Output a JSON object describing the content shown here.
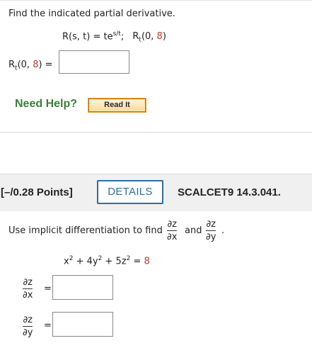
{
  "problem1": {
    "prompt": "Find the indicated partial derivative.",
    "func_lhs": "R(s, t) = te",
    "func_exp": "s/t",
    "func_sep": ";",
    "target_R": "R",
    "target_sub": "t",
    "target_open": "(0, ",
    "target_val": "8",
    "target_close": ")",
    "answer_label_open": "(0, ",
    "answer_label_val": "8",
    "answer_label_close": ") =",
    "answer_value": "",
    "need_help": "Need Help?",
    "read_it": "Read It"
  },
  "problem2": {
    "points": "[–/0.28 Points]",
    "details_button": "DETAILS",
    "code": "SCALCET9 14.3.041.",
    "prompt": "Use implicit differentiation to find",
    "and": "and",
    "period": ".",
    "dz": "∂z",
    "dx": "∂x",
    "dy": "∂y",
    "eq_x": "x",
    "eq_2a": "2",
    "eq_plus1": " + 4y",
    "eq_2b": "2",
    "eq_plus2": " + 5z",
    "eq_2c": "2",
    "eq_equals": " = ",
    "eq_rhs": "8",
    "answer_dzdx": "",
    "answer_dzdy": "",
    "equals": "="
  },
  "colors": {
    "accent_blue": "#2a6fa1",
    "help_green": "#3a7f3a",
    "highlight_red": "#c0392b",
    "header_bg": "#f0f0f0"
  }
}
